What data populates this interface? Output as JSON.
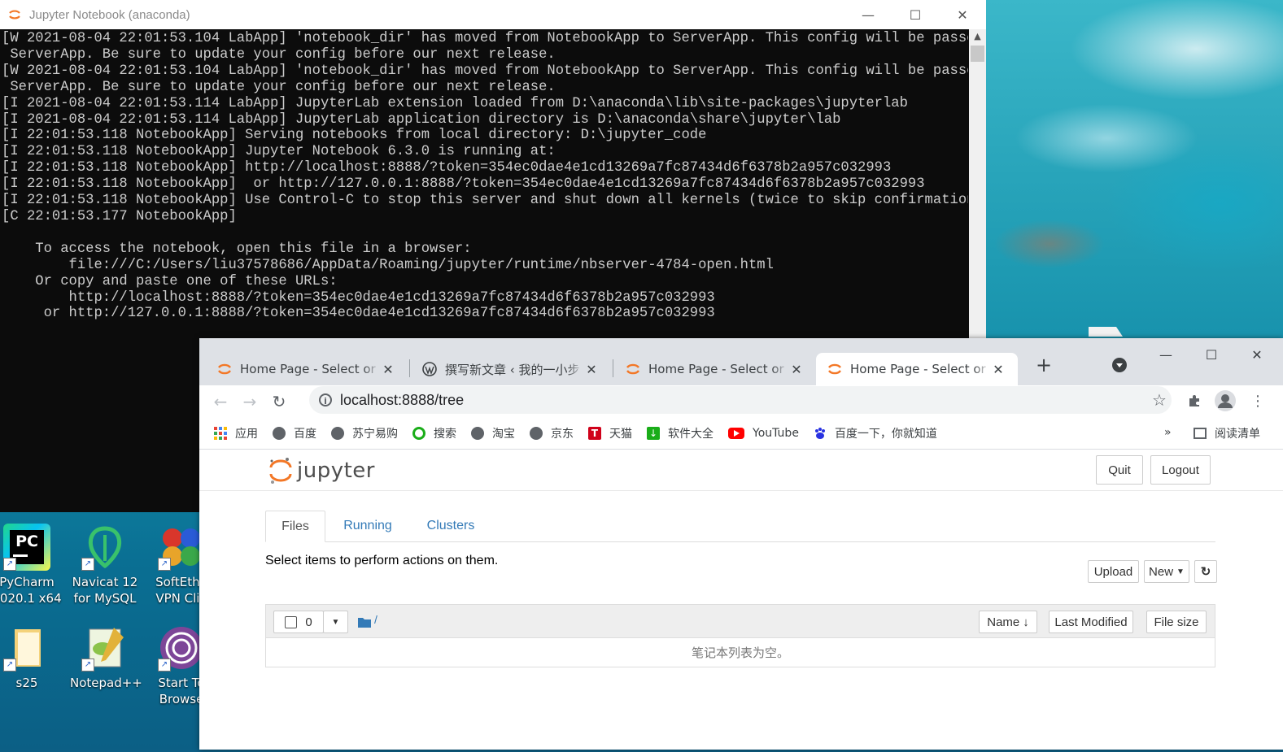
{
  "console": {
    "title": "Jupyter Notebook (anaconda)",
    "lines": [
      "[W 2021-08-04 22:01:53.104 LabApp] 'notebook_dir' has moved from NotebookApp to ServerApp. This config will be passed to",
      " ServerApp. Be sure to update your config before our next release.",
      "[W 2021-08-04 22:01:53.104 LabApp] 'notebook_dir' has moved from NotebookApp to ServerApp. This config will be passed to",
      " ServerApp. Be sure to update your config before our next release.",
      "[I 2021-08-04 22:01:53.114 LabApp] JupyterLab extension loaded from D:\\anaconda\\lib\\site-packages\\jupyterlab",
      "[I 2021-08-04 22:01:53.114 LabApp] JupyterLab application directory is D:\\anaconda\\share\\jupyter\\lab",
      "[I 22:01:53.118 NotebookApp] Serving notebooks from local directory: D:\\jupyter_code",
      "[I 22:01:53.118 NotebookApp] Jupyter Notebook 6.3.0 is running at:",
      "[I 22:01:53.118 NotebookApp] http://localhost:8888/?token=354ec0dae4e1cd13269a7fc87434d6f6378b2a957c032993",
      "[I 22:01:53.118 NotebookApp]  or http://127.0.0.1:8888/?token=354ec0dae4e1cd13269a7fc87434d6f6378b2a957c032993",
      "[I 22:01:53.118 NotebookApp] Use Control-C to stop this server and shut down all kernels (twice to skip confirmation).",
      "[C 22:01:53.177 NotebookApp]",
      "",
      "    To access the notebook, open this file in a browser:",
      "        file:///C:/Users/liu37578686/AppData/Roaming/jupyter/runtime/nbserver-4784-open.html",
      "    Or copy and paste one of these URLs:",
      "        http://localhost:8888/?token=354ec0dae4e1cd13269a7fc87434d6f6378b2a957c032993",
      "     or http://127.0.0.1:8888/?token=354ec0dae4e1cd13269a7fc87434d6f6378b2a957c032993"
    ]
  },
  "desktop": {
    "icons": [
      {
        "label1": "PyCharm",
        "label2": "2020.1 x64",
        "icon": "pycharm-icon"
      },
      {
        "label1": "Navicat 12",
        "label2": "for MySQL",
        "icon": "navicat-icon"
      },
      {
        "label1": "SoftEthe",
        "label2": "VPN Clie",
        "icon": "softether-icon"
      },
      {
        "label1": "s25",
        "label2": "",
        "icon": "folder-icon"
      },
      {
        "label1": "Notepad++",
        "label2": "",
        "icon": "notepadpp-icon"
      },
      {
        "label1": "Start To",
        "label2": "Browse",
        "icon": "tor-browser-icon"
      }
    ]
  },
  "browser": {
    "tabs": [
      {
        "label": "Home Page - Select or create a notebook",
        "icon": "jupyter-icon",
        "active": false
      },
      {
        "label": "撰写新文章 ‹ 我的一小步 — WordPress",
        "icon": "wordpress-icon",
        "active": false
      },
      {
        "label": "Home Page - Select or create a notebook",
        "icon": "jupyter-icon",
        "active": false
      },
      {
        "label": "Home Page - Select or create a notebook",
        "icon": "jupyter-icon",
        "active": true
      }
    ],
    "new_tab": "+",
    "url": "localhost:8888/tree",
    "bookmarks": [
      {
        "label": "应用",
        "icon": "apps-grid-icon"
      },
      {
        "label": "百度",
        "icon": "globe-icon"
      },
      {
        "label": "苏宁易购",
        "icon": "globe-icon"
      },
      {
        "label": "搜索",
        "icon": "search-circle-icon"
      },
      {
        "label": "淘宝",
        "icon": "globe-icon"
      },
      {
        "label": "京东",
        "icon": "globe-icon"
      },
      {
        "label": "天猫",
        "icon": "tmall-icon"
      },
      {
        "label": "软件大全",
        "icon": "download-icon"
      },
      {
        "label": "YouTube",
        "icon": "youtube-icon"
      },
      {
        "label": "百度一下，你就知道",
        "icon": "baidu-paw-icon"
      }
    ],
    "bookmarks_more": "»",
    "reading_list": "阅读清单"
  },
  "jupyter": {
    "logo_text": "jupyter",
    "quit": "Quit",
    "logout": "Logout",
    "tabs": [
      "Files",
      "Running",
      "Clusters"
    ],
    "hint": "Select items to perform actions on them.",
    "upload": "Upload",
    "new": "New",
    "selected_count": "0",
    "breadcrumb": "/",
    "columns": {
      "name": "Name",
      "last_modified": "Last Modified",
      "file_size": "File size"
    },
    "empty_message": "笔记本列表为空。"
  },
  "colors": {
    "jupyter_orange": "#f37726",
    "link_blue": "#337ab7",
    "console_bg": "#0c0c0c",
    "console_fg": "#cccccc"
  }
}
